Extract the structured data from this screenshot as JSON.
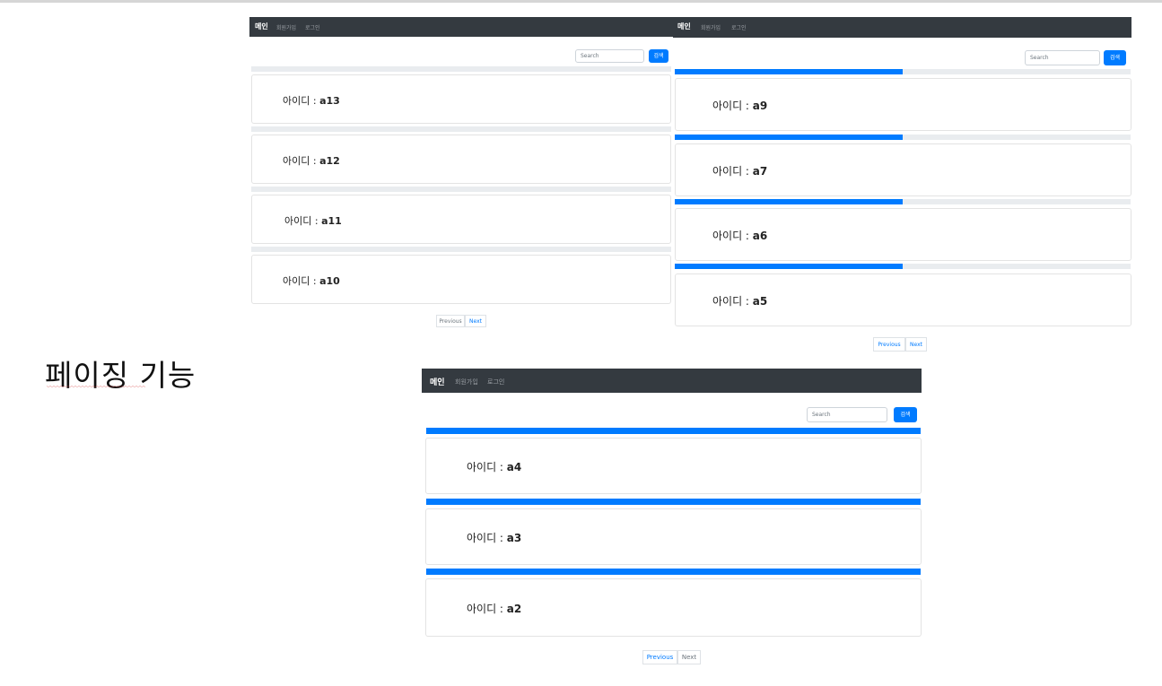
{
  "caption": "페이징 기능",
  "screens": [
    {
      "nav": {
        "brand": "메인",
        "links": [
          "회원가입",
          "로그인"
        ]
      },
      "search": {
        "placeholder": "Search",
        "button": "검색"
      },
      "cards": [
        {
          "label": "아이디 : ",
          "id": "a13",
          "progress": 0
        },
        {
          "label": "아이디 : ",
          "id": "a12",
          "progress": 0
        },
        {
          "label": "아이디 : ",
          "id": "a11",
          "progress": 0
        },
        {
          "label": "아이디 : ",
          "id": "a10",
          "progress": 0
        }
      ],
      "pager": {
        "previous": "Previous",
        "next": "Next",
        "active": "next"
      }
    },
    {
      "nav": {
        "brand": "메인",
        "links": [
          "회원가입",
          "로그인"
        ]
      },
      "search": {
        "placeholder": "Search",
        "button": "검색"
      },
      "cards": [
        {
          "label": "아이디 : ",
          "id": "a9",
          "progress": 0.5
        },
        {
          "label": "아이디 : ",
          "id": "a7",
          "progress": 0.5
        },
        {
          "label": "아이디 : ",
          "id": "a6",
          "progress": 0.5
        },
        {
          "label": "아이디 : ",
          "id": "a5",
          "progress": 0.5
        }
      ],
      "pager": {
        "previous": "Previous",
        "next": "Next",
        "active": "both"
      }
    },
    {
      "nav": {
        "brand": "메인",
        "links": [
          "회원가입",
          "로그인"
        ]
      },
      "search": {
        "placeholder": "Search",
        "button": "검색"
      },
      "cards": [
        {
          "label": "아이디 : ",
          "id": "a4",
          "progress": 1
        },
        {
          "label": "아이디 : ",
          "id": "a3",
          "progress": 1
        },
        {
          "label": "아이디 : ",
          "id": "a2",
          "progress": 1
        }
      ],
      "pager": {
        "previous": "Previous",
        "next": "Next",
        "active": "previous"
      }
    }
  ],
  "colors": {
    "navbar": "#343a40",
    "primary": "#007bff",
    "track": "#e9ecef"
  }
}
